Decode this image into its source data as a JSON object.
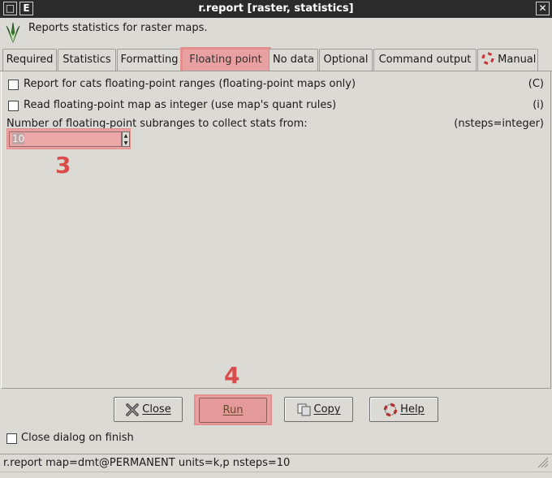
{
  "window": {
    "title": "r.report [raster, statistics]",
    "menu_glyph": "E"
  },
  "header": {
    "description": "Reports statistics for raster maps."
  },
  "tabs": [
    {
      "label": "Required"
    },
    {
      "label": "Statistics"
    },
    {
      "label": "Formatting"
    },
    {
      "label": "Floating point",
      "active": true
    },
    {
      "label": "No data"
    },
    {
      "label": "Optional"
    },
    {
      "label": "Command output"
    },
    {
      "label": "Manual"
    }
  ],
  "panel": {
    "option_c": {
      "label": "Report for cats floating-point ranges (floating-point maps only)",
      "flag": "(C)",
      "checked": false
    },
    "option_i": {
      "label": "Read floating-point map as integer (use map's quant rules)",
      "flag": "(i)",
      "checked": false
    },
    "nsteps": {
      "label": "Number of floating-point subranges to collect stats from:",
      "param": "(nsteps=integer)",
      "value": "10"
    }
  },
  "markers": {
    "m3": "3",
    "m4": "4"
  },
  "buttons": {
    "close": "Close",
    "run": "Run",
    "copy": "Copy",
    "help": "Help"
  },
  "close_on_finish": {
    "label": "Close dialog on finish",
    "checked": false
  },
  "status": {
    "command": "r.report map=dmt@PERMANENT units=k,p nsteps=10"
  },
  "colors": {
    "highlight": "#e8a0a0",
    "marker": "#d94c4c",
    "titlebar": "#2b2b2b",
    "background": "#dcdad5"
  }
}
